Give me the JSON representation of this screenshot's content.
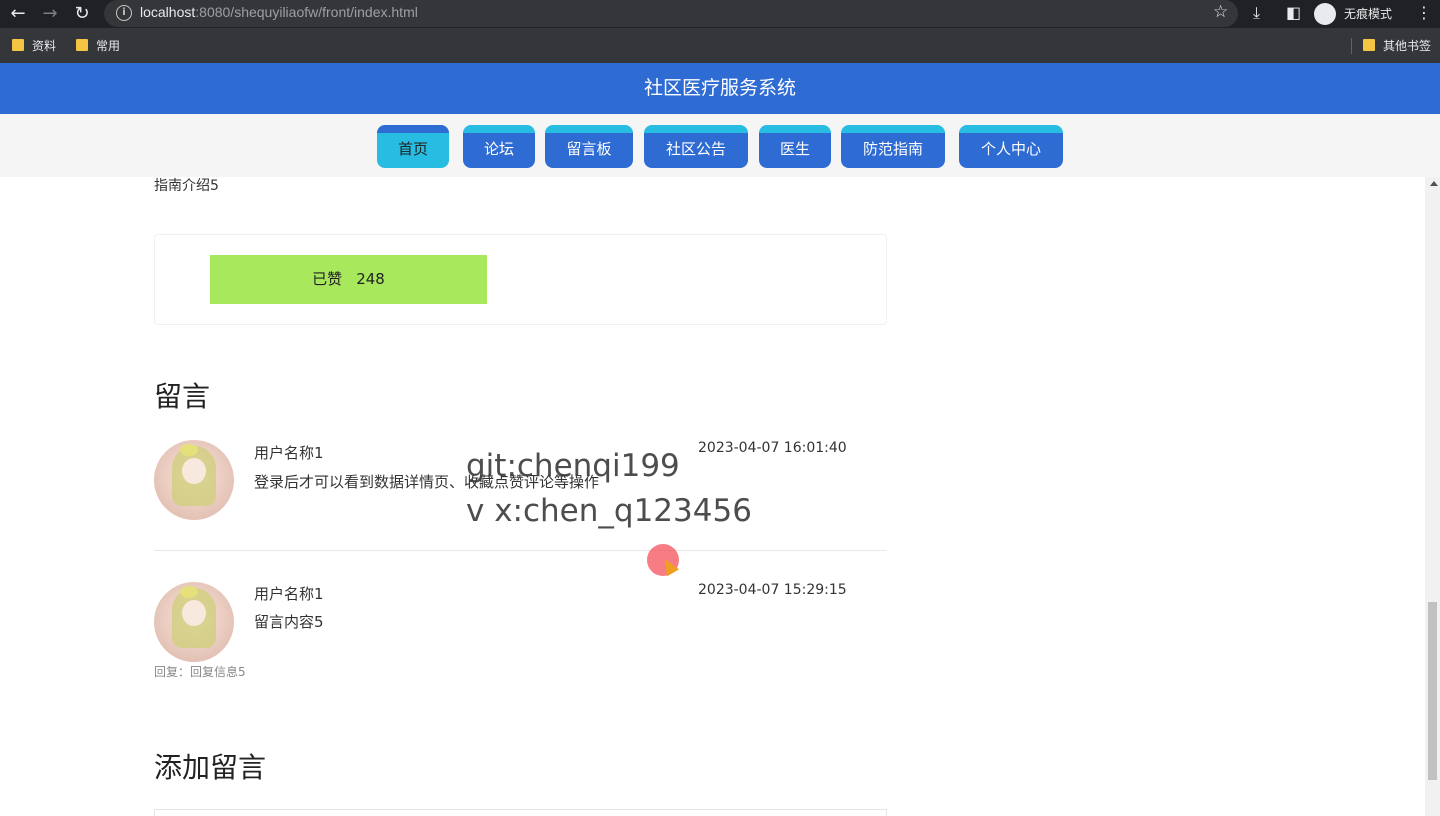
{
  "browser": {
    "url_host": "localhost",
    "url_rest": ":8080/shequyiliaofw/front/index.html",
    "incognito_label": "无痕模式",
    "bookmarks": [
      "资料",
      "常用"
    ],
    "other_bookmarks": "其他书签"
  },
  "site": {
    "title": "社区医疗服务系统",
    "nav": [
      "首页",
      "论坛",
      "留言板",
      "社区公告",
      "医生",
      "防范指南",
      "个人中心"
    ],
    "active_nav": "首页"
  },
  "detail": {
    "intro_text": "指南介绍5",
    "like_label": "已赞",
    "like_count": "248"
  },
  "messages_section": {
    "title": "留言",
    "items": [
      {
        "user": "用户名称1",
        "time": "2023-04-07 16:01:40",
        "content": "登录后才可以看到数据详情页、收藏点赞评论等操作"
      },
      {
        "user": "用户名称1",
        "time": "2023-04-07 15:29:15",
        "content": "留言内容5",
        "reply": "回复：回复信息5"
      }
    ]
  },
  "add_message": {
    "title": "添加留言"
  },
  "watermark": {
    "line1": "git:chenqi199",
    "line2": "v x:chen_q123456"
  }
}
